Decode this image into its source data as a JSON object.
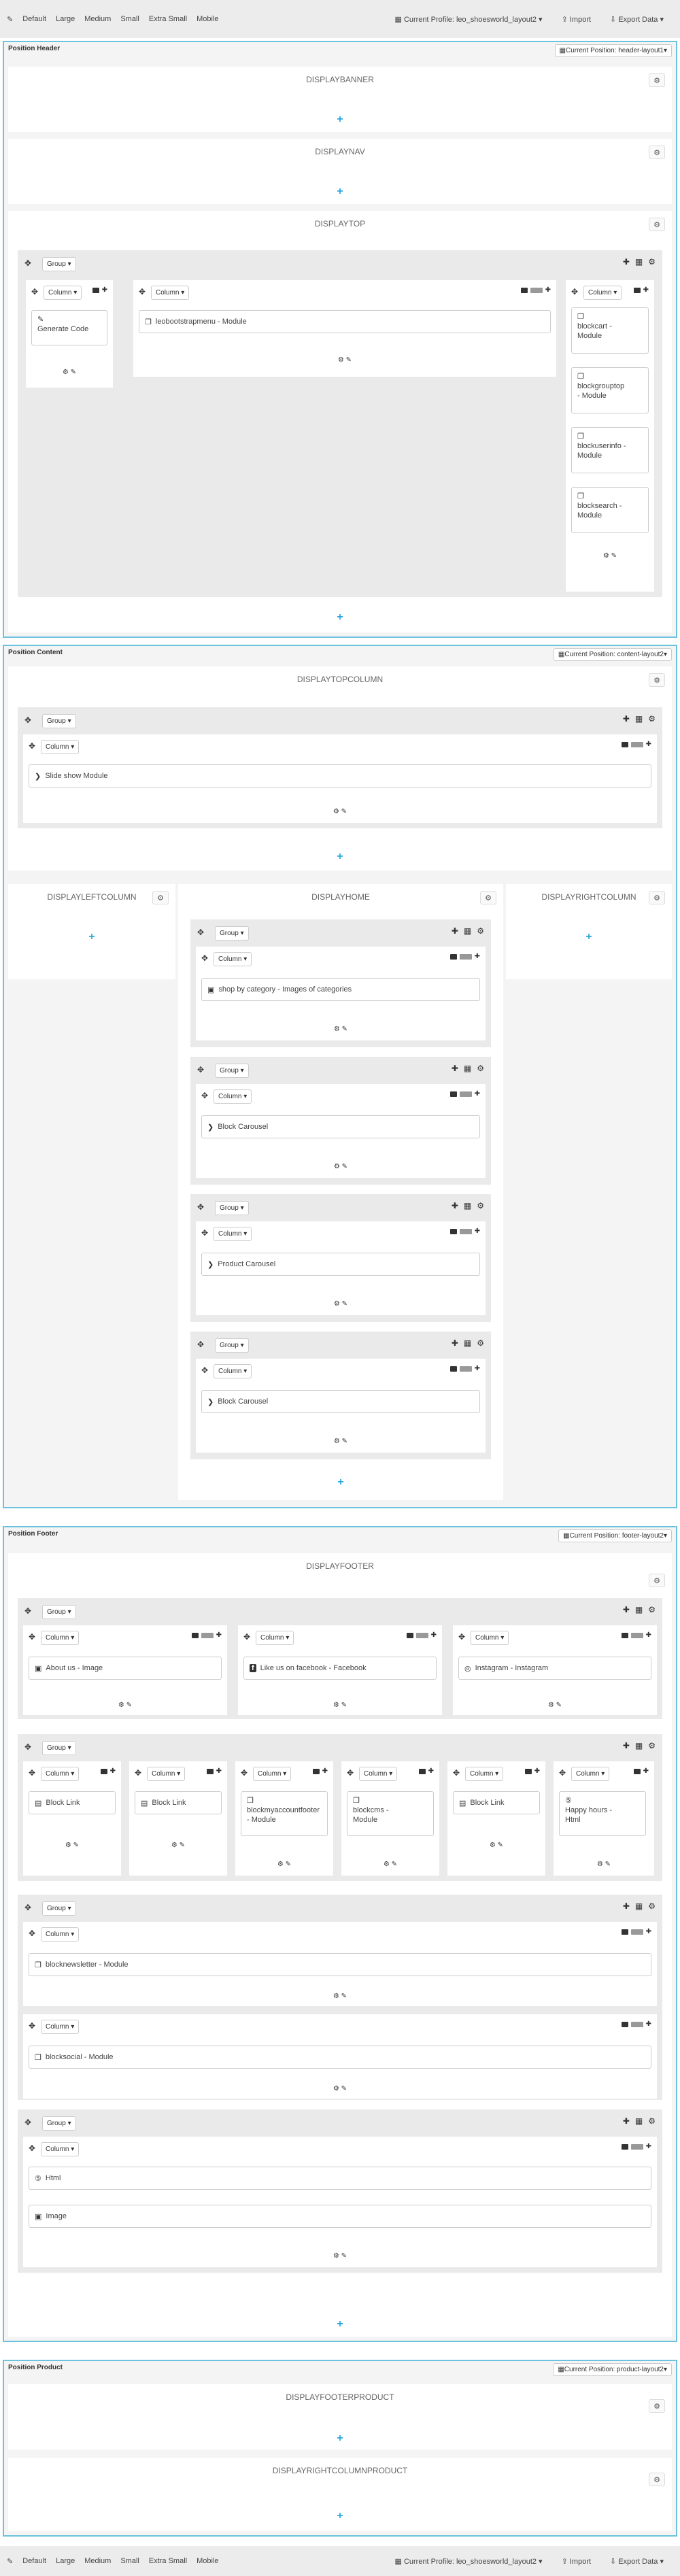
{
  "toolbar": {
    "edit_icon": "pencil-icon",
    "devices": [
      "Default",
      "Large",
      "Medium",
      "Small",
      "Extra Small",
      "Mobile"
    ],
    "profile": "Current Profile: leo_shoesworld_layout2",
    "import": "Import",
    "export": "Export Data"
  },
  "header": {
    "title": "Position Header",
    "current": "Current Position: header-layout1",
    "hooks": {
      "banner": "DISPLAYBANNER",
      "nav": "DISPLAYNAV",
      "top": "DISPLAYTOP"
    },
    "group_label": "Group",
    "column_label": "Column",
    "modules": {
      "generate_code": "Generate Code",
      "bootstrapmenu": "leobootstrapmenu - Module",
      "blockcart_a": "blockcart -",
      "blockcart_b": "Module",
      "grouptop_a": "blockgrouptop",
      "grouptop_b": "- Module",
      "userinfo_a": "blockuserinfo -",
      "userinfo_b": "Module",
      "search_a": "blocksearch -",
      "search_b": "Module"
    }
  },
  "content": {
    "title": "Position Content",
    "current": "Current Position: content-layout2",
    "hooks": {
      "topcolumn": "DISPLAYTOPCOLUMN",
      "leftcolumn": "DISPLAYLEFTCOLUMN",
      "home": "DISPLAYHOME",
      "rightcolumn": "DISPLAYRIGHTCOLUMN"
    },
    "modules": {
      "slideshow": "Slide show Module",
      "shop_by_category": "shop by category - Images of categories",
      "block_carousel_1": "Block Carousel",
      "product_carousel": "Product Carousel",
      "block_carousel_2": "Block Carousel"
    }
  },
  "footer": {
    "title": "Position Footer",
    "current": "Current Position: footer-layout2",
    "hooks": {
      "footer": "DISPLAYFOOTER"
    },
    "modules": {
      "about": "About us - Image",
      "facebook": "Like us on facebook - Facebook",
      "instagram": "Instagram - Instagram",
      "block_link_1": "Block Link",
      "block_link_2": "Block Link",
      "myaccount_a": "blockmyaccountfooter",
      "myaccount_b": "- Module",
      "cms_a": "blockcms -",
      "cms_b": "Module",
      "block_link_3": "Block Link",
      "happy_a": "Happy hours -",
      "happy_b": "Html",
      "newsletter": "blocknewsletter - Module",
      "social": "blocksocial - Module",
      "html": "Html",
      "image": "Image"
    }
  },
  "product": {
    "title": "Position Product",
    "current": "Current Position: product-layout2",
    "hooks": {
      "footerproduct": "DISPLAYFOOTERPRODUCT",
      "rightcolumnproduct": "DISPLAYRIGHTCOLUMNPRODUCT"
    }
  },
  "icons": {
    "move": "✥",
    "gear": "⚙",
    "pencil": "✎",
    "plus": "+",
    "caret": "▾",
    "grid": "▦",
    "module": "❐",
    "code": "✎",
    "image": "▣",
    "html": "5",
    "link": "▤",
    "facebook": "f",
    "instagram": "◎",
    "chevron": "›"
  }
}
